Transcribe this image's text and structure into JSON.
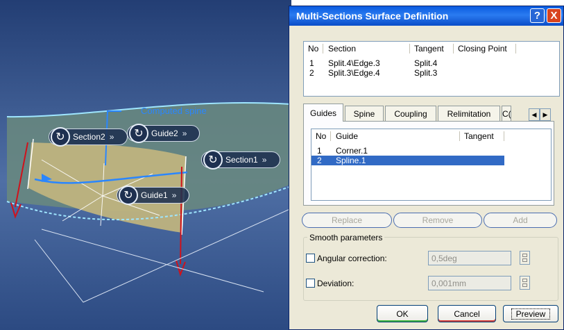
{
  "viewport": {
    "spine_label": "Computed spine",
    "tags": {
      "section2": "Section2",
      "guide2": "Guide2",
      "section1": "Section1",
      "guide1": "Guide1",
      "chevron": "»"
    }
  },
  "dialog": {
    "title": "Multi-Sections Surface Definition",
    "help_glyph": "?",
    "close_glyph": "X",
    "sections_table": {
      "headers": [
        "No",
        "Section",
        "Tangent",
        "Closing Point"
      ],
      "rows": [
        {
          "no": "1",
          "section": "Split.4\\Edge.3",
          "tangent": "Split.4"
        },
        {
          "no": "2",
          "section": "Split.3\\Edge.4",
          "tangent": "Split.3"
        }
      ]
    },
    "tabs": [
      "Guides",
      "Spine",
      "Coupling",
      "Relimitation",
      "C("
    ],
    "active_tab": "Guides",
    "tab_scroll": {
      "left": "◀",
      "right": "▶"
    },
    "guides_table": {
      "headers": [
        "No",
        "Guide",
        "Tangent"
      ],
      "rows": [
        {
          "no": "1",
          "guide": "Corner.1",
          "selected": false
        },
        {
          "no": "2",
          "guide": "Spline.1",
          "selected": true
        }
      ]
    },
    "actions": {
      "replace": "Replace",
      "remove": "Remove",
      "add": "Add"
    },
    "smooth": {
      "title": "Smooth parameters",
      "angular_label": "Angular correction:",
      "angular_value": "0,5deg",
      "deviation_label": "Deviation:",
      "deviation_value": "0,001mm"
    },
    "buttons": {
      "ok": "OK",
      "cancel": "Cancel",
      "preview": "Preview"
    }
  },
  "colors": {
    "title_bar": "#0a5be0",
    "selection": "#316ac5",
    "spine": "#2a86ff",
    "arrow": "#d0121b"
  }
}
